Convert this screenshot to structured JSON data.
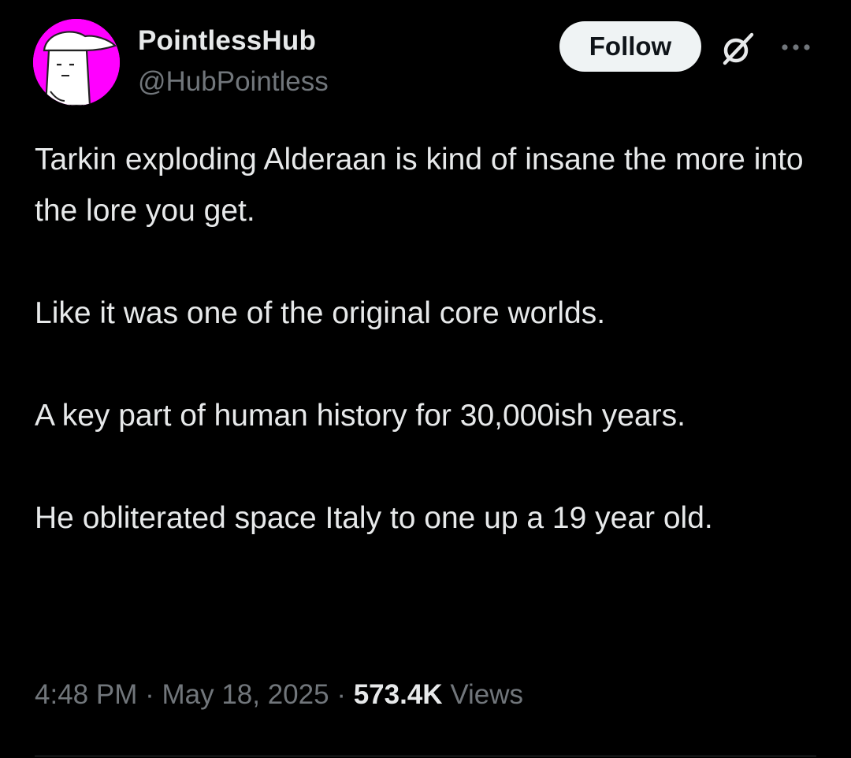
{
  "author": {
    "display_name": "PointlessHub",
    "handle": "@HubPointless",
    "avatar_color": "#ff00ff"
  },
  "actions": {
    "follow_label": "Follow",
    "grok_icon": "grok-icon",
    "more_icon": "more-horizontal-icon"
  },
  "tweet": {
    "paragraphs": [
      "Tarkin exploding Alderaan is kind of insane the more into the lore you get.",
      "Like it was one of the original core worlds.",
      "A key part of human history for 30,000ish years.",
      "He obliterated space Italy to one up a 19 year old."
    ]
  },
  "meta": {
    "time": "4:48 PM",
    "separator": "·",
    "date": "May 18, 2025",
    "views_count": "573.4K",
    "views_label": "Views"
  },
  "colors": {
    "background": "#000000",
    "text_primary": "#e7e9ea",
    "text_secondary": "#71767b",
    "button_bg": "#eff3f4",
    "button_text": "#0f1419"
  }
}
